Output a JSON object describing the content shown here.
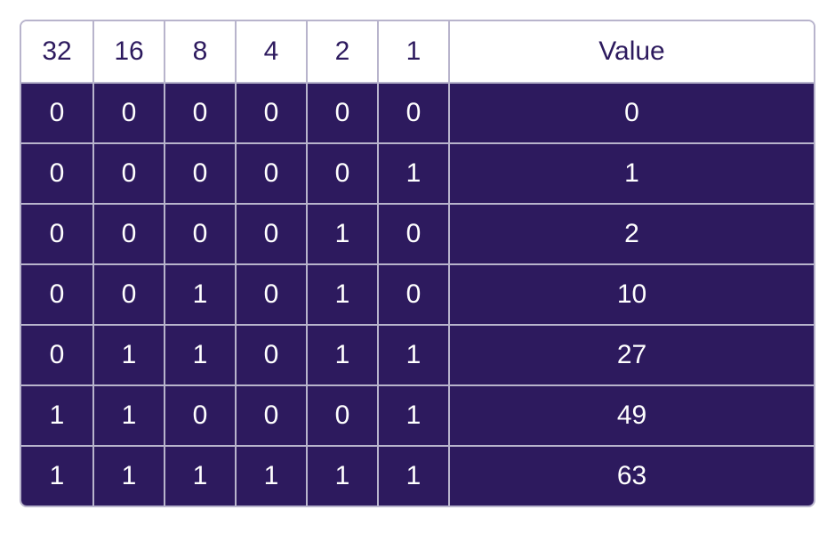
{
  "chart_data": {
    "type": "table",
    "headers": [
      "32",
      "16",
      "8",
      "4",
      "2",
      "1",
      "Value"
    ],
    "rows": [
      [
        "0",
        "0",
        "0",
        "0",
        "0",
        "0",
        "0"
      ],
      [
        "0",
        "0",
        "0",
        "0",
        "0",
        "1",
        "1"
      ],
      [
        "0",
        "0",
        "0",
        "0",
        "1",
        "0",
        "2"
      ],
      [
        "0",
        "0",
        "1",
        "0",
        "1",
        "0",
        "10"
      ],
      [
        "0",
        "1",
        "1",
        "0",
        "1",
        "1",
        "27"
      ],
      [
        "1",
        "1",
        "0",
        "0",
        "0",
        "1",
        "49"
      ],
      [
        "1",
        "1",
        "1",
        "1",
        "1",
        "1",
        "63"
      ]
    ]
  },
  "colors": {
    "header_bg": "#ffffff",
    "header_text": "#2d1a5e",
    "data_bg": "#2d1a5e",
    "data_text": "#ffffff",
    "border": "#b8b4cc"
  }
}
